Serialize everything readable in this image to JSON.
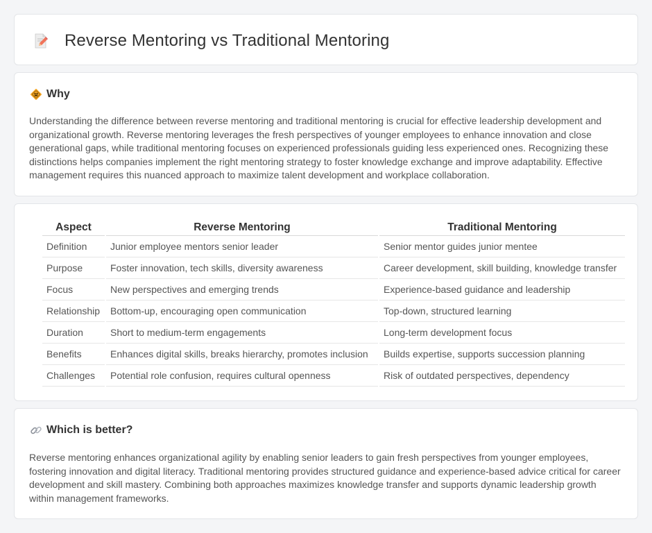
{
  "header": {
    "title": "Reverse Mentoring vs Traditional Mentoring",
    "icon": "document-pencil-icon"
  },
  "why": {
    "title": "Why",
    "icon": "diamond-sign-icon",
    "text": "Understanding the difference between reverse mentoring and traditional mentoring is crucial for effective leadership development and organizational growth. Reverse mentoring leverages the fresh perspectives of younger employees to enhance innovation and close generational gaps, while traditional mentoring focuses on experienced professionals guiding less experienced ones. Recognizing these distinctions helps companies implement the right mentoring strategy to foster knowledge exchange and improve adaptability. Effective management requires this nuanced approach to maximize talent development and workplace collaboration."
  },
  "comparison": {
    "headers": [
      "Aspect",
      "Reverse Mentoring",
      "Traditional Mentoring"
    ],
    "rows": [
      [
        "Definition",
        "Junior employee mentors senior leader",
        "Senior mentor guides junior mentee"
      ],
      [
        "Purpose",
        "Foster innovation, tech skills, diversity awareness",
        "Career development, skill building, knowledge transfer"
      ],
      [
        "Focus",
        "New perspectives and emerging trends",
        "Experience-based guidance and leadership"
      ],
      [
        "Relationship",
        "Bottom-up, encouraging open communication",
        "Top-down, structured learning"
      ],
      [
        "Duration",
        "Short to medium-term engagements",
        "Long-term development focus"
      ],
      [
        "Benefits",
        "Enhances digital skills, breaks hierarchy, promotes inclusion",
        "Builds expertise, supports succession planning"
      ],
      [
        "Challenges",
        "Potential role confusion, requires cultural openness",
        "Risk of outdated perspectives, dependency"
      ]
    ]
  },
  "better": {
    "title": "Which is better?",
    "icon": "link-icon",
    "text": "Reverse mentoring enhances organizational agility by enabling senior leaders to gain fresh perspectives from younger employees, fostering innovation and digital literacy. Traditional mentoring provides structured guidance and experience-based advice critical for career development and skill mastery. Combining both approaches maximizes knowledge transfer and supports dynamic leadership growth within management frameworks."
  }
}
